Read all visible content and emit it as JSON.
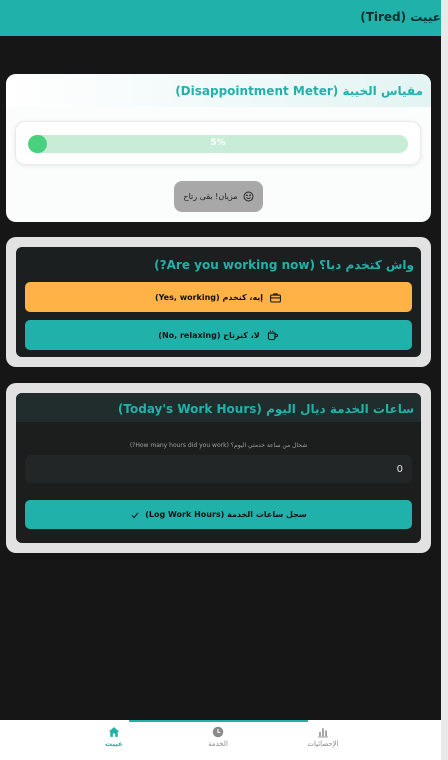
{
  "header": {
    "title": "عييت (Tired)"
  },
  "meter_card": {
    "title": "مقياس الخيبة (Disappointment Meter)",
    "progress_percent": 5,
    "progress_label": "5%",
    "mood_label": "مزيان! بقى رتاح",
    "mood_icon": "smile-icon"
  },
  "working_card": {
    "title": "واش كتخدم دبا؟ (Are you working now?)",
    "yes_label": "إيه، كنخدم (Yes, working)",
    "yes_icon": "briefcase-icon",
    "no_label": "لا، كنرتاح (No, relaxing)",
    "no_icon": "coffee-cup-icon"
  },
  "hours_card": {
    "title": "ساعات الخدمة ديال اليوم (Today's Work Hours)",
    "question": "شحال من ساعة خدمتي اليوم؟ (How many hours did you work?)",
    "hours_value": "0",
    "log_label": "سجل ساعات الخدمة (Log Work Hours)",
    "log_icon": "check-icon"
  },
  "nav": {
    "home": "عييت",
    "service": "الخدمة",
    "stats": "الإحصائيات"
  },
  "colors": {
    "accent": "#20b2aa",
    "yes_button": "#ffb347",
    "meter_fill": "#49d17f",
    "meter_track": "#c8ecd5",
    "background": "#161616"
  }
}
